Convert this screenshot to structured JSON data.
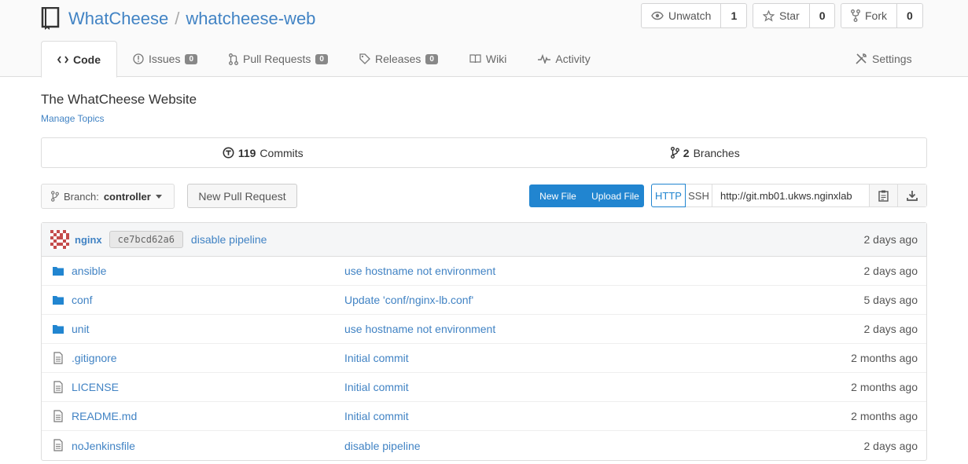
{
  "header": {
    "org": "WhatCheese",
    "separator": "/",
    "repo": "whatcheese-web",
    "watch": {
      "label": "Unwatch",
      "count": "1"
    },
    "star": {
      "label": "Star",
      "count": "0"
    },
    "fork": {
      "label": "Fork",
      "count": "0"
    }
  },
  "tabs": [
    {
      "label": "Code",
      "icon": "code-icon"
    },
    {
      "label": "Issues",
      "badge": "0",
      "icon": "issue-icon"
    },
    {
      "label": "Pull Requests",
      "badge": "0",
      "icon": "pull-request-icon"
    },
    {
      "label": "Releases",
      "badge": "0",
      "icon": "tag-icon"
    },
    {
      "label": "Wiki",
      "icon": "book-icon"
    },
    {
      "label": "Activity",
      "icon": "pulse-icon"
    }
  ],
  "settings_label": "Settings",
  "description": "The WhatCheese Website",
  "manage_topics": "Manage Topics",
  "stats": {
    "commits_count": "119",
    "commits_label": "Commits",
    "branches_count": "2",
    "branches_label": "Branches"
  },
  "toolbar": {
    "branch_prefix": "Branch:",
    "branch_name": "controller",
    "new_pull_request": "New Pull Request",
    "new_file": "New File",
    "upload_file": "Upload File",
    "http": "HTTP",
    "ssh": "SSH",
    "clone_url": "http://git.mb01.ukws.nginxlab"
  },
  "latest_commit": {
    "author": "nginx",
    "sha": "ce7bcd62a6",
    "message": "disable pipeline",
    "time": "2 days ago"
  },
  "files": [
    {
      "name": "ansible",
      "type": "folder",
      "message": "use hostname not environment",
      "time": "2 days ago"
    },
    {
      "name": "conf",
      "type": "folder",
      "message": "Update 'conf/nginx-lb.conf'",
      "time": "5 days ago"
    },
    {
      "name": "unit",
      "type": "folder",
      "message": "use hostname not environment",
      "time": "2 days ago"
    },
    {
      "name": ".gitignore",
      "type": "file",
      "message": "Initial commit",
      "time": "2 months ago"
    },
    {
      "name": "LICENSE",
      "type": "file",
      "message": "Initial commit",
      "time": "2 months ago"
    },
    {
      "name": "README.md",
      "type": "file",
      "message": "Initial commit",
      "time": "2 months ago"
    },
    {
      "name": "noJenkinsfile",
      "type": "file",
      "message": "disable pipeline",
      "time": "2 days ago"
    }
  ],
  "colors": {
    "link": "#4183c4",
    "primary_button": "#2185d0",
    "folder": "#2185d0"
  }
}
